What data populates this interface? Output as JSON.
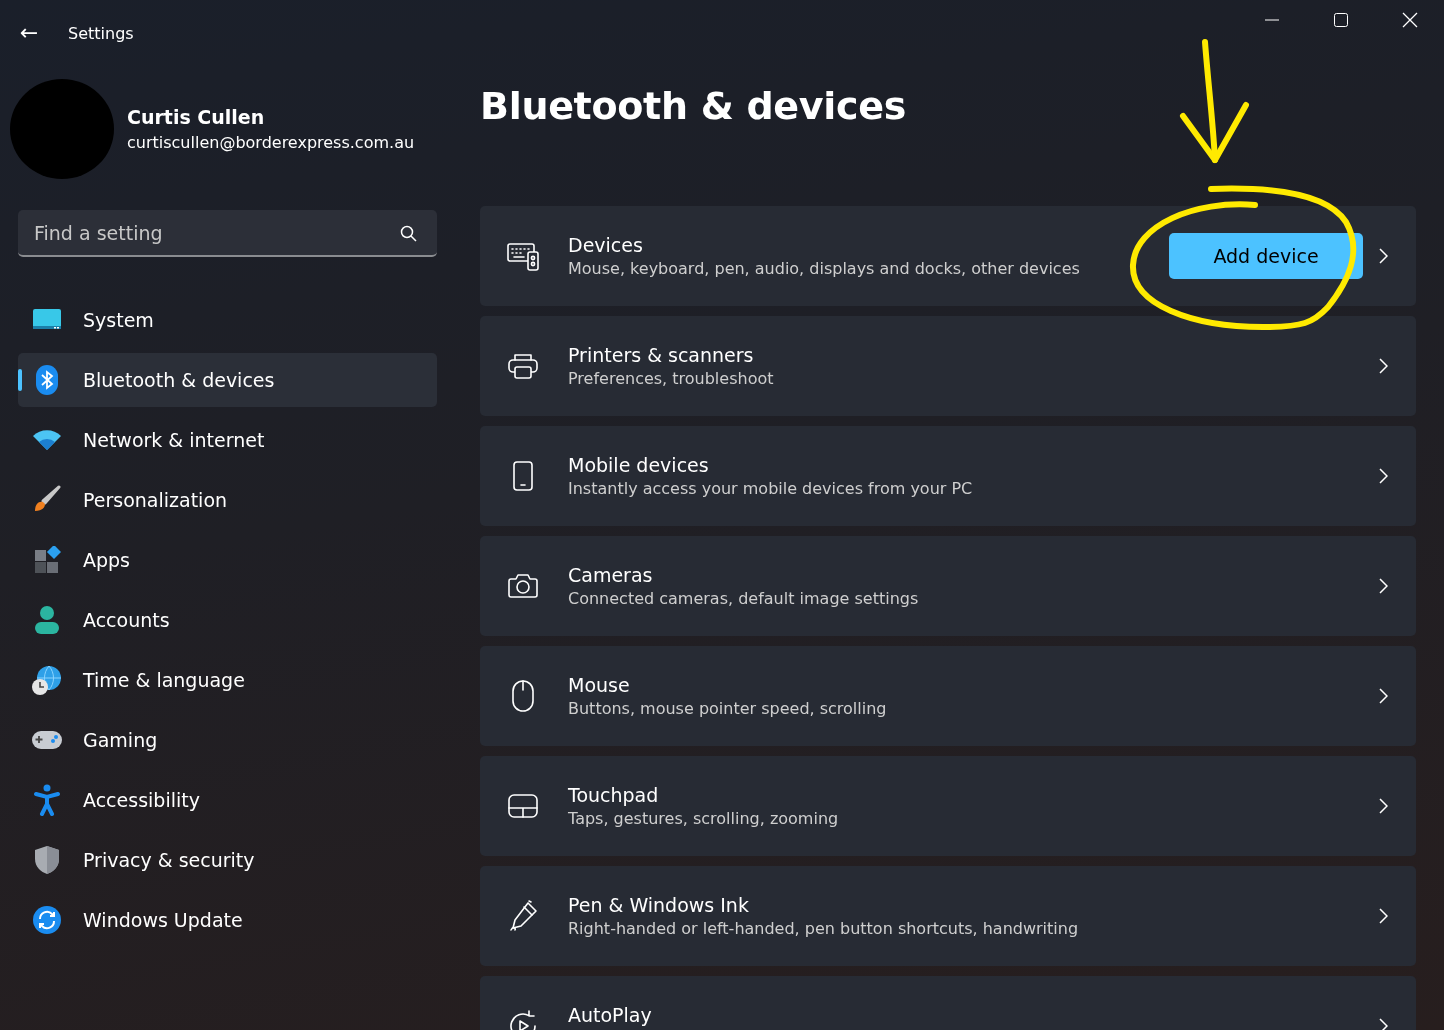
{
  "window": {
    "title": "Settings",
    "back": "←"
  },
  "profile": {
    "name": "Curtis Cullen",
    "email": "curtiscullen@borderexpress.com.au"
  },
  "search": {
    "placeholder": "Find a setting"
  },
  "sidebar": {
    "items": [
      {
        "label": "System",
        "selected": false
      },
      {
        "label": "Bluetooth & devices",
        "selected": true
      },
      {
        "label": "Network & internet",
        "selected": false
      },
      {
        "label": "Personalization",
        "selected": false
      },
      {
        "label": "Apps",
        "selected": false
      },
      {
        "label": "Accounts",
        "selected": false
      },
      {
        "label": "Time & language",
        "selected": false
      },
      {
        "label": "Gaming",
        "selected": false
      },
      {
        "label": "Accessibility",
        "selected": false
      },
      {
        "label": "Privacy & security",
        "selected": false
      },
      {
        "label": "Windows Update",
        "selected": false
      }
    ]
  },
  "page": {
    "title": "Bluetooth & devices",
    "cards": [
      {
        "title": "Devices",
        "subtitle": "Mouse, keyboard, pen, audio, displays and docks, other devices",
        "button": "Add device"
      },
      {
        "title": "Printers & scanners",
        "subtitle": "Preferences, troubleshoot"
      },
      {
        "title": "Mobile devices",
        "subtitle": "Instantly access your mobile devices from your PC"
      },
      {
        "title": "Cameras",
        "subtitle": "Connected cameras, default image settings"
      },
      {
        "title": "Mouse",
        "subtitle": "Buttons, mouse pointer speed, scrolling"
      },
      {
        "title": "Touchpad",
        "subtitle": "Taps, gestures, scrolling, zooming"
      },
      {
        "title": "Pen & Windows Ink",
        "subtitle": "Right-handed or left-handed, pen button shortcuts, handwriting"
      },
      {
        "title": "AutoPlay"
      }
    ]
  }
}
